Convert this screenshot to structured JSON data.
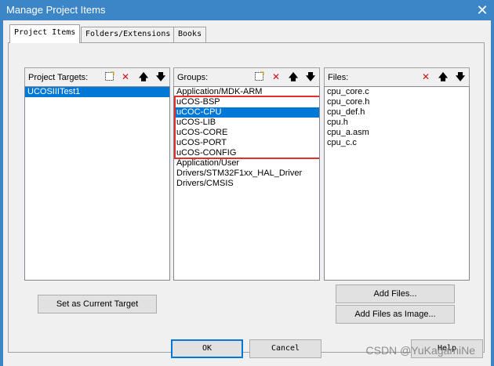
{
  "window": {
    "title": "Manage Project Items"
  },
  "tabs": [
    {
      "label": "Project Items",
      "active": true
    },
    {
      "label": "Folders/Extensions",
      "active": false
    },
    {
      "label": "Books",
      "active": false
    }
  ],
  "targets": {
    "title": "Project Targets:",
    "items": [
      {
        "label": "UCOSIIITest1",
        "selected": true
      }
    ]
  },
  "groups": {
    "title": "Groups:",
    "items": [
      {
        "label": "Application/MDK-ARM",
        "selected": false
      },
      {
        "label": "uCOS-BSP",
        "selected": false
      },
      {
        "label": "uCOC-CPU",
        "selected": true
      },
      {
        "label": "uCOS-LIB",
        "selected": false
      },
      {
        "label": "uCOS-CORE",
        "selected": false
      },
      {
        "label": "uCOS-PORT",
        "selected": false
      },
      {
        "label": "uCOS-CONFIG",
        "selected": false
      },
      {
        "label": "Application/User",
        "selected": false
      },
      {
        "label": "Drivers/STM32F1xx_HAL_Driver",
        "selected": false
      },
      {
        "label": "Drivers/CMSIS",
        "selected": false
      }
    ]
  },
  "files": {
    "title": "Files:",
    "items": [
      {
        "label": "cpu_core.c"
      },
      {
        "label": "cpu_core.h"
      },
      {
        "label": "cpu_def.h"
      },
      {
        "label": "cpu.h"
      },
      {
        "label": "cpu_a.asm"
      },
      {
        "label": "cpu_c.c"
      }
    ]
  },
  "buttons": {
    "set_current_target": "Set as Current Target",
    "add_files": "Add Files...",
    "add_files_as_image": "Add Files as Image...",
    "ok": "OK",
    "cancel": "Cancel",
    "help": "Help"
  },
  "watermark": "CSDN @YuKagamiNe",
  "colors": {
    "title_bar": "#3c85c6",
    "selection": "#0078d7",
    "highlight_box": "#e03030"
  }
}
